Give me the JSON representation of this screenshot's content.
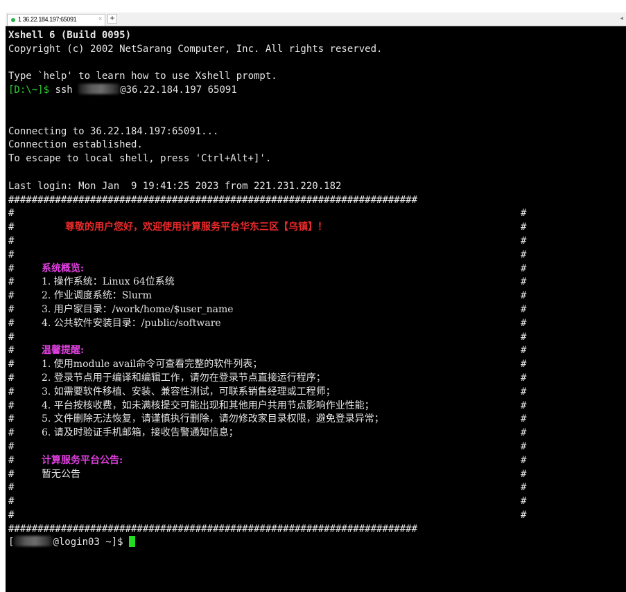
{
  "tab": {
    "title": "1 36.22.184.197:65091",
    "close": "×",
    "new_tab": "+",
    "scroll": "◂"
  },
  "terminal": {
    "banner1": "Xshell 6 (Build 0095)",
    "banner2": "Copyright (c) 2002 NetSarang Computer, Inc. All rights reserved.",
    "help": "Type `help' to learn how to use Xshell prompt.",
    "local_prompt": "[D:\\~]$",
    "ssh_cmd": " ssh ",
    "ssh_host": "@36.22.184.197 65091",
    "connecting": "Connecting to 36.22.184.197:65091...",
    "established": "Connection established.",
    "escape": "To escape to local shell, press 'Ctrl+Alt+]'.",
    "last_login": "Last login: Mon Jan  9 19:41:25 2023 from 221.231.220.182",
    "border": "######################################################################",
    "hash": "#",
    "welcome": "尊敬的用户您好，欢迎使用计算服务平台华东三区【乌镇】！",
    "overview_title": "系统概览:",
    "overview": [
      "1. 操作系统：Linux 64位系统",
      "2. 作业调度系统：Slurm",
      "3. 用户家目录：/work/home/$user_name",
      "4. 公共软件安装目录：/public/software"
    ],
    "tips_title": "温馨提醒:",
    "tips": [
      "1. 使用module avail命令可查看完整的软件列表；",
      "2. 登录节点用于编译和编辑工作，请勿在登录节点直接运行程序；",
      "3. 如需要软件移植、安装、兼容性测试，可联系销售经理或工程师；",
      "4. 平台按核收费，如未满核提交可能出现和其他用户共用节点影响作业性能；",
      "5. 文件删除无法恢复，请谨慎执行删除，请勿修改家目录权限，避免登录异常；",
      "6. 请及时验证手机邮箱，接收告警通知信息；"
    ],
    "notice_title": "计算服务平台公告:",
    "notice_body": "暂无公告",
    "remote_prompt_open": "[",
    "remote_prompt_host": "@login03 ~]$ "
  },
  "colors": {
    "prompt_green": "#30d030",
    "welcome_red": "#ee2a2a",
    "heading_magenta": "#e040e0",
    "cursor_green": "#22dd22",
    "terminal_bg": "#000000"
  }
}
